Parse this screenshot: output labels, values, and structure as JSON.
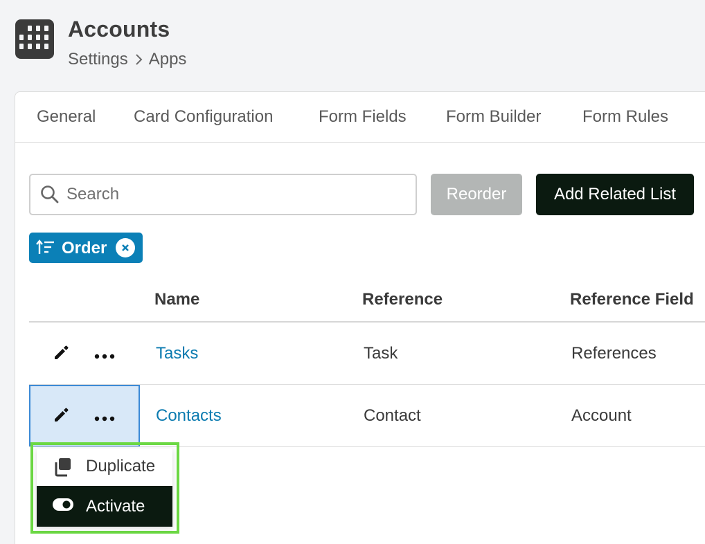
{
  "header": {
    "icon": "building-icon",
    "title": "Accounts",
    "breadcrumb": [
      "Settings",
      "Apps"
    ]
  },
  "tabs": [
    {
      "label": "General"
    },
    {
      "label": "Card Configuration"
    },
    {
      "label": "Form Fields"
    },
    {
      "label": "Form Builder"
    },
    {
      "label": "Form Rules"
    }
  ],
  "toolbar": {
    "search_placeholder": "Search",
    "search_value": "",
    "reorder_label": "Reorder",
    "add_label": "Add Related List"
  },
  "filter_chip": {
    "label": "Order",
    "icon": "sort-ascending-icon"
  },
  "table": {
    "columns": [
      "Name",
      "Reference",
      "Reference Field"
    ],
    "rows": [
      {
        "name": "Tasks",
        "reference": "Task",
        "reference_field": "References"
      },
      {
        "name": "Contacts",
        "reference": "Contact",
        "reference_field": "Account"
      }
    ]
  },
  "menu": {
    "items": [
      {
        "label": "Duplicate",
        "icon": "duplicate-icon"
      },
      {
        "label": "Activate",
        "icon": "toggle-icon"
      }
    ]
  },
  "colors": {
    "accent": "#0b80b7",
    "primary_button": "#0b1a10",
    "disabled_button": "#b3b6b5",
    "link": "#0b7bb0",
    "selection": "#d8e8f8",
    "highlight": "#6cd844"
  }
}
